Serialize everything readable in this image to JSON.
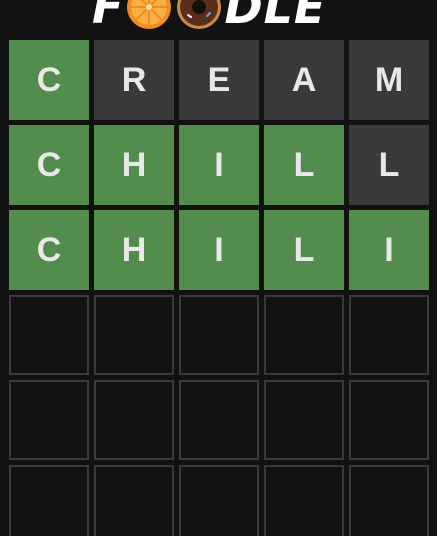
{
  "header": {
    "logo_prefix": "F",
    "logo_suffix": "DLE",
    "logo_icons": [
      "orange-slice-icon",
      "donut-icon"
    ]
  },
  "colors": {
    "background": "#121213",
    "correct": "#538d4e",
    "absent": "#3a3a3c",
    "present": "#b59f3b",
    "empty_border": "#3a3a3c"
  },
  "board": {
    "rows": [
      {
        "letters": [
          "C",
          "R",
          "E",
          "A",
          "M"
        ],
        "states": [
          "correct",
          "absent",
          "absent",
          "absent",
          "absent"
        ]
      },
      {
        "letters": [
          "C",
          "H",
          "I",
          "L",
          "L"
        ],
        "states": [
          "correct",
          "correct",
          "correct",
          "correct",
          "absent"
        ]
      },
      {
        "letters": [
          "C",
          "H",
          "I",
          "L",
          "I"
        ],
        "states": [
          "correct",
          "correct",
          "correct",
          "correct",
          "correct"
        ]
      },
      {
        "letters": [
          "",
          "",
          "",
          "",
          ""
        ],
        "states": [
          "empty",
          "empty",
          "empty",
          "empty",
          "empty"
        ]
      },
      {
        "letters": [
          "",
          "",
          "",
          "",
          ""
        ],
        "states": [
          "empty",
          "empty",
          "empty",
          "empty",
          "empty"
        ]
      },
      {
        "letters": [
          "",
          "",
          "",
          "",
          ""
        ],
        "states": [
          "empty",
          "empty",
          "empty",
          "empty",
          "empty"
        ]
      }
    ]
  }
}
